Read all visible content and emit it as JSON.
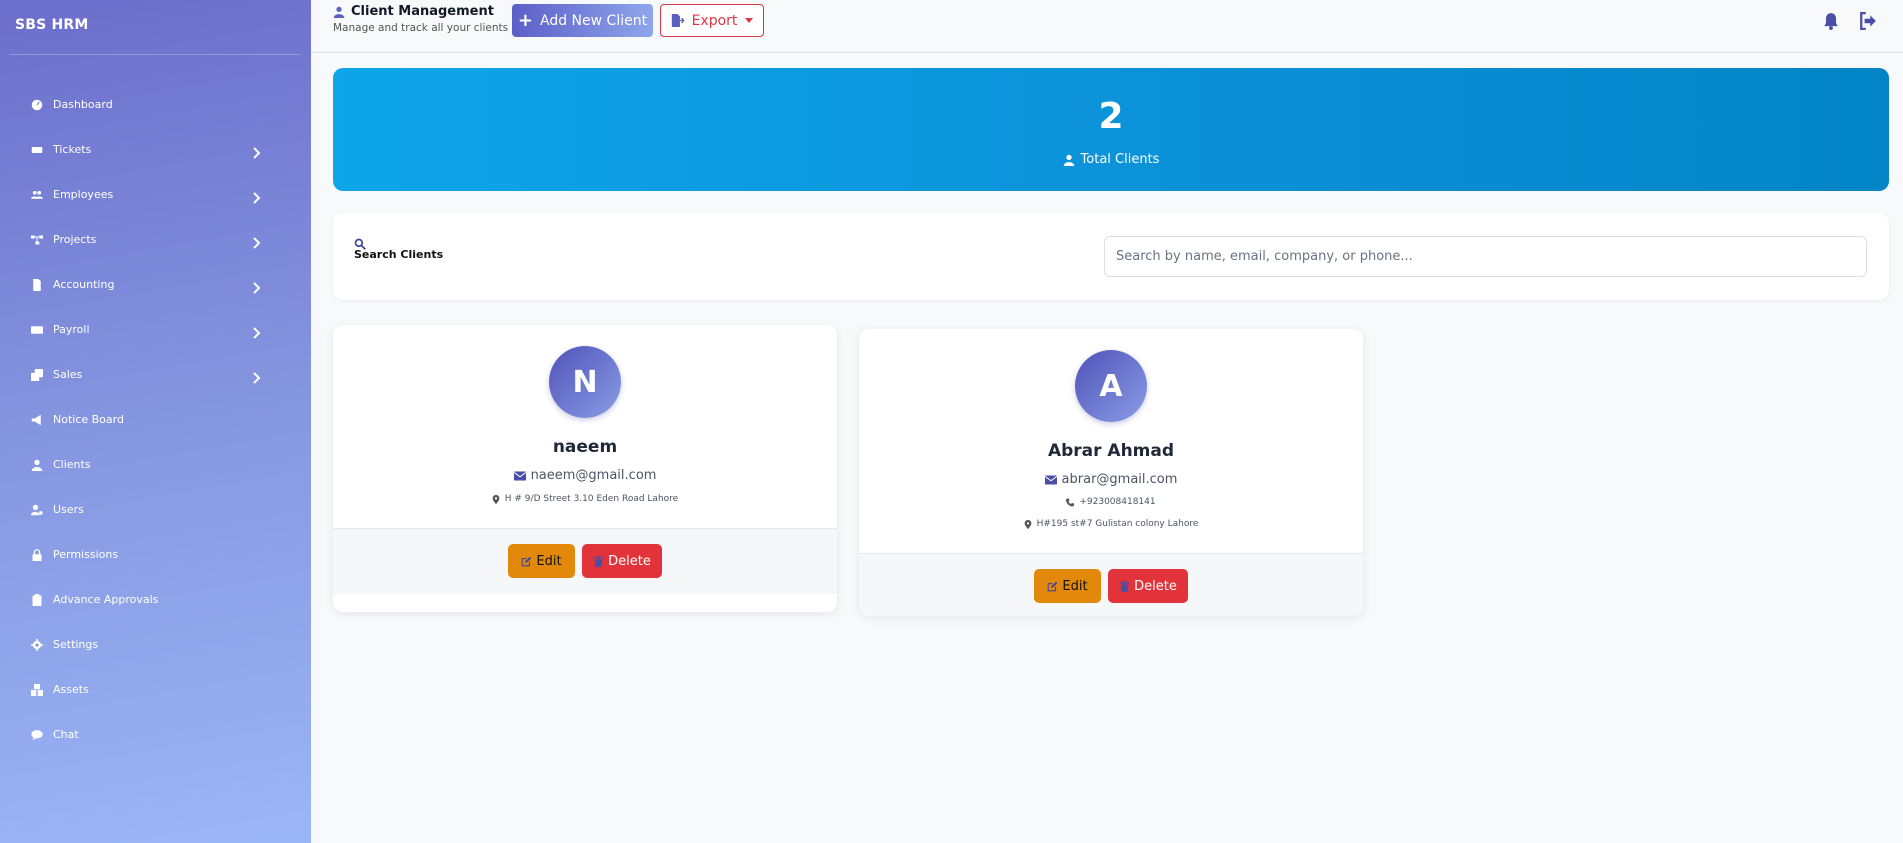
{
  "sidebar": {
    "brand": "SBS HRM",
    "items": [
      {
        "label": "Dashboard",
        "icon": "dashboard-icon",
        "chevron": false
      },
      {
        "label": "Tickets",
        "icon": "ticket-icon",
        "chevron": true
      },
      {
        "label": "Employees",
        "icon": "users-icon",
        "chevron": true
      },
      {
        "label": "Projects",
        "icon": "sitemap-icon",
        "chevron": true
      },
      {
        "label": "Accounting",
        "icon": "file-invoice-icon",
        "chevron": true
      },
      {
        "label": "Payroll",
        "icon": "money-icon",
        "chevron": true
      },
      {
        "label": "Sales",
        "icon": "clone-icon",
        "chevron": true
      },
      {
        "label": "Notice Board",
        "icon": "bullhorn-icon",
        "chevron": false
      },
      {
        "label": "Clients",
        "icon": "user-icon",
        "chevron": false
      },
      {
        "label": "Users",
        "icon": "user-cog-icon",
        "chevron": false
      },
      {
        "label": "Permissions",
        "icon": "lock-icon",
        "chevron": false
      },
      {
        "label": "Advance Approvals",
        "icon": "clipboard-check-icon",
        "chevron": false
      },
      {
        "label": "Settings",
        "icon": "gear-icon",
        "chevron": false
      },
      {
        "label": "Assets",
        "icon": "boxes-icon",
        "chevron": false
      },
      {
        "label": "Chat",
        "icon": "chat-icon",
        "chevron": false
      }
    ]
  },
  "header": {
    "title": "Client Management",
    "subtitle": "Manage and track all your clients",
    "add_label": "Add New Client",
    "export_label": "Export"
  },
  "stats": {
    "total_value": "2",
    "total_label": "Total Clients"
  },
  "search": {
    "label": "Search Clients",
    "placeholder": "Search by name, email, company, or phone..."
  },
  "clients": [
    {
      "initial": "N",
      "name": "naeem",
      "email": "naeem@gmail.com",
      "phone": "",
      "address": "H # 9/D Street 3.10 Eden Road Lahore",
      "edit_label": "Edit",
      "delete_label": "Delete"
    },
    {
      "initial": "A",
      "name": "Abrar Ahmad",
      "email": "abrar@gmail.com",
      "phone": "+923008418141",
      "address": "H#195 st#7 Gulistan colony Lahore",
      "edit_label": "Edit",
      "delete_label": "Delete"
    }
  ],
  "colors": {
    "accent": "#5b5fc7",
    "stats_bg": "#0ea5e9",
    "edit": "#e2890c",
    "delete": "#e2333a"
  }
}
